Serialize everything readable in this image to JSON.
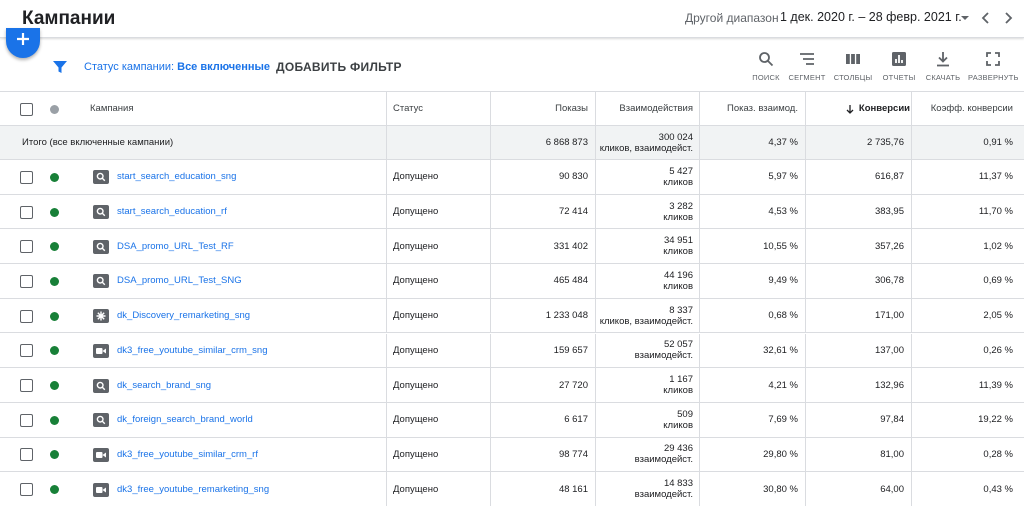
{
  "header": {
    "title": "Кампании",
    "range_label": "Другой диапазон",
    "range_value": "1 дек. 2020 г. – 28 февр. 2021 г."
  },
  "filter": {
    "status_prefix": "Статус кампании:",
    "status_value": "Все включенные",
    "add_filter": "ДОБАВИТЬ ФИЛЬТР"
  },
  "tools": [
    {
      "icon": "search-icon",
      "label": "ПОИСК"
    },
    {
      "icon": "segment-icon",
      "label": "СЕГМЕНТ"
    },
    {
      "icon": "columns-icon",
      "label": "СТОЛБЦЫ"
    },
    {
      "icon": "reports-icon",
      "label": "ОТЧЕТЫ"
    },
    {
      "icon": "download-icon",
      "label": "СКАЧАТЬ"
    },
    {
      "icon": "expand-icon",
      "label": "РАЗВЕРНУТЬ"
    }
  ],
  "columns": {
    "campaign": "Кампания",
    "status": "Статус",
    "impressions": "Показы",
    "interactions": "Взаимодействия",
    "interaction_rate": "Показ. взаимод.",
    "conversions": "Конверсии",
    "conv_rate": "Коэфф. конверсии"
  },
  "total": {
    "label": "Итого (все включенные кампании)",
    "impressions": "6 868 873",
    "interactions_value": "300 024",
    "interactions_unit": "кликов, взаимодейст.",
    "interaction_rate": "4,37 %",
    "conversions": "2 735,76",
    "conv_rate": "0,91 %"
  },
  "rows": [
    {
      "type": "search",
      "name": "start_search_education_sng",
      "status": "Допущено",
      "impressions": "90 830",
      "int_value": "5 427",
      "int_unit": "кликов",
      "int_rate": "5,97 %",
      "conversions": "616,87",
      "conv_rate": "11,37 %"
    },
    {
      "type": "search",
      "name": "start_search_education_rf",
      "status": "Допущено",
      "impressions": "72 414",
      "int_value": "3 282",
      "int_unit": "кликов",
      "int_rate": "4,53 %",
      "conversions": "383,95",
      "conv_rate": "11,70 %"
    },
    {
      "type": "search",
      "name": "DSA_promo_URL_Test_RF",
      "status": "Допущено",
      "impressions": "331 402",
      "int_value": "34 951",
      "int_unit": "кликов",
      "int_rate": "10,55 %",
      "conversions": "357,26",
      "conv_rate": "1,02 %"
    },
    {
      "type": "search",
      "name": "DSA_promo_URL_Test_SNG",
      "status": "Допущено",
      "impressions": "465 484",
      "int_value": "44 196",
      "int_unit": "кликов",
      "int_rate": "9,49 %",
      "conversions": "306,78",
      "conv_rate": "0,69 %"
    },
    {
      "type": "discovery",
      "name": "dk_Discovery_remarketing_sng",
      "status": "Допущено",
      "impressions": "1 233 048",
      "int_value": "8 337",
      "int_unit": "кликов, взаимодейст.",
      "int_rate": "0,68 %",
      "conversions": "171,00",
      "conv_rate": "2,05 %"
    },
    {
      "type": "video",
      "name": "dk3_free_youtube_similar_crm_sng",
      "status": "Допущено",
      "impressions": "159 657",
      "int_value": "52 057",
      "int_unit": "взаимодейст.",
      "int_rate": "32,61 %",
      "conversions": "137,00",
      "conv_rate": "0,26 %"
    },
    {
      "type": "search",
      "name": "dk_search_brand_sng",
      "status": "Допущено",
      "impressions": "27 720",
      "int_value": "1 167",
      "int_unit": "кликов",
      "int_rate": "4,21 %",
      "conversions": "132,96",
      "conv_rate": "11,39 %"
    },
    {
      "type": "search",
      "name": "dk_foreign_search_brand_world",
      "status": "Допущено",
      "impressions": "6 617",
      "int_value": "509",
      "int_unit": "кликов",
      "int_rate": "7,69 %",
      "conversions": "97,84",
      "conv_rate": "19,22 %"
    },
    {
      "type": "video",
      "name": "dk3_free_youtube_similar_crm_rf",
      "status": "Допущено",
      "impressions": "98 774",
      "int_value": "29 436",
      "int_unit": "взаимодейст.",
      "int_rate": "29,80 %",
      "conversions": "81,00",
      "conv_rate": "0,28 %"
    },
    {
      "type": "video",
      "name": "dk3_free_youtube_remarketing_sng",
      "status": "Допущено",
      "impressions": "48 161",
      "int_value": "14 833",
      "int_unit": "взаимодейст.",
      "int_rate": "30,80 %",
      "conversions": "64,00",
      "conv_rate": "0,43 %"
    }
  ],
  "colors": {
    "accent": "#1a73e8",
    "enabled": "#188038",
    "border": "#dadce0"
  }
}
